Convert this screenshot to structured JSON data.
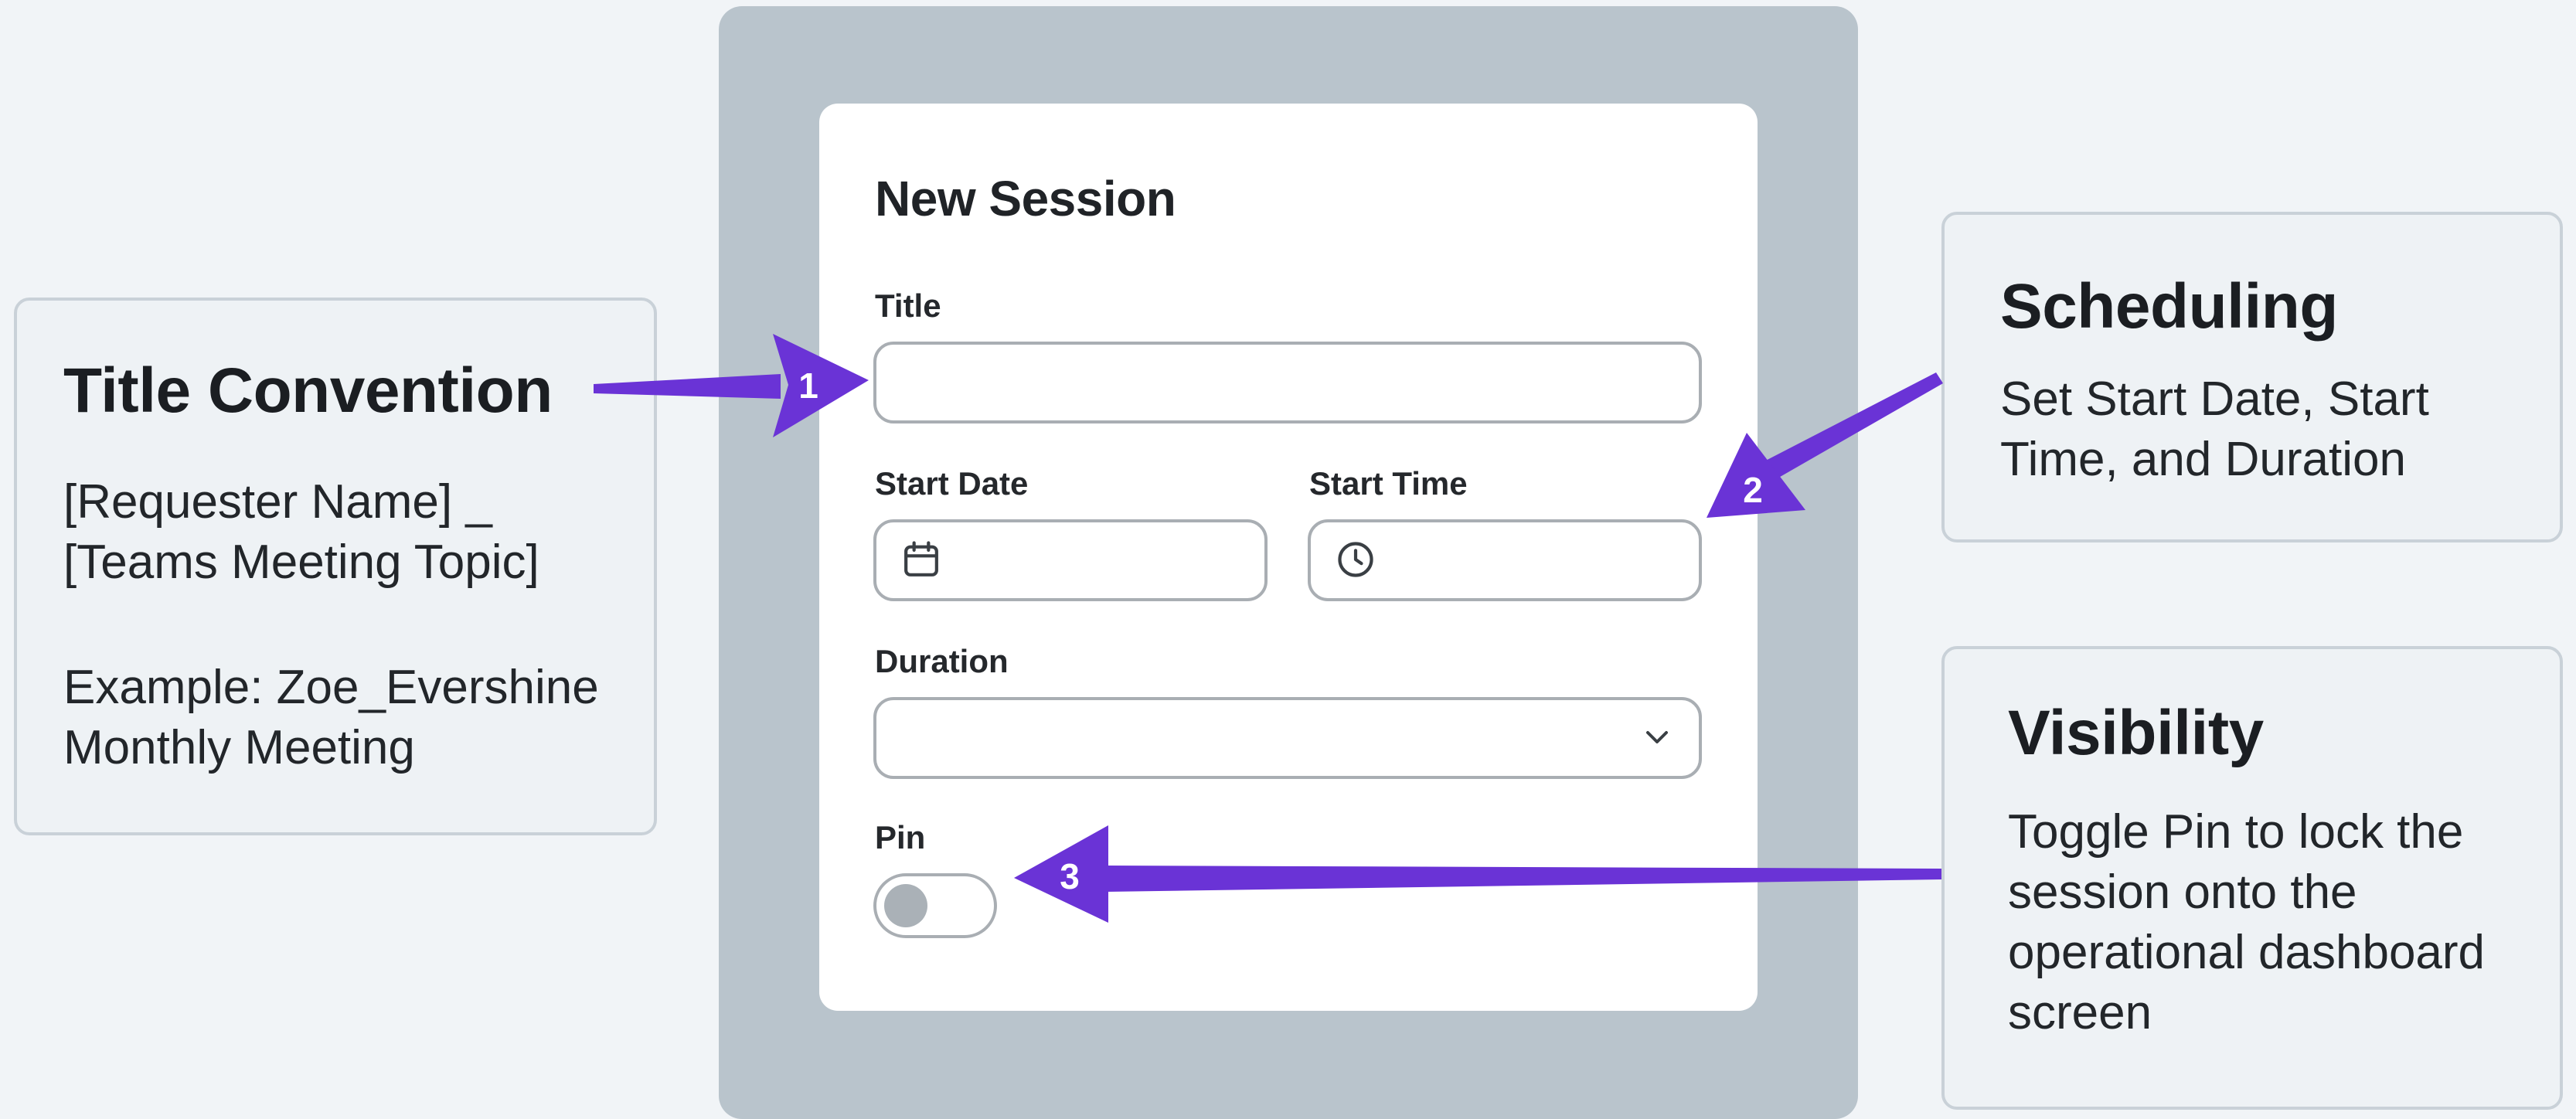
{
  "dialog": {
    "title": "New Session",
    "fields": {
      "title": {
        "label": "Title",
        "value": ""
      },
      "start_date": {
        "label": "Start Date",
        "value": "",
        "icon": "calendar-icon"
      },
      "start_time": {
        "label": "Start Time",
        "value": "",
        "icon": "clock-icon"
      },
      "duration": {
        "label": "Duration",
        "value": "",
        "icon": "chevron-down-icon"
      },
      "pin": {
        "label": "Pin",
        "on": false
      }
    }
  },
  "callouts": {
    "title_convention": {
      "heading": "Title Convention",
      "line1": "[Requester Name] _",
      "line2": "[Teams Meeting Topic]",
      "line3": "Example: Zoe_Evershine",
      "line4": "Monthly Meeting"
    },
    "scheduling": {
      "heading": "Scheduling",
      "line1": "Set Start Date, Start",
      "line2": "Time, and Duration"
    },
    "visibility": {
      "heading": "Visibility",
      "line1": "Toggle Pin to lock the",
      "line2": "session onto the",
      "line3": "operational dashboard",
      "line4": "screen"
    }
  },
  "markers": [
    "1",
    "2",
    "3"
  ],
  "colors": {
    "arrow": "#6a33d6",
    "backdrop": "#b9c4cc",
    "border": "#a9aeb3"
  }
}
